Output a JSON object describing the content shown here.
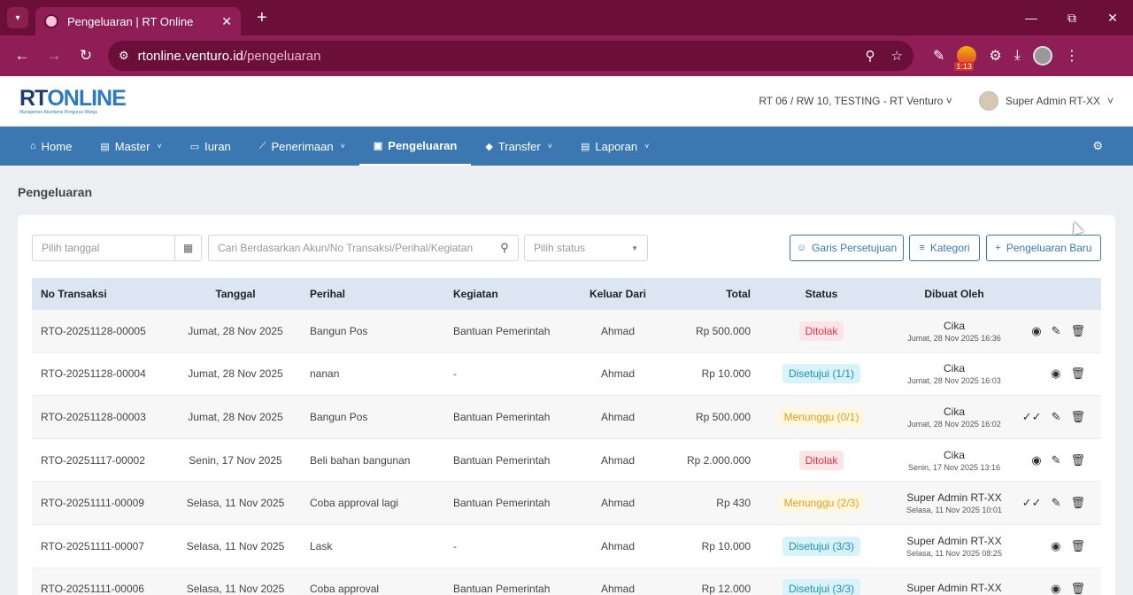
{
  "browser": {
    "tab_title": "Pengeluaran | RT Online",
    "tab_close": "✕",
    "new_tab": "+",
    "url_host": "rtonline.venturo.id",
    "url_path": "/pengeluaran",
    "ext_badge": "1:13"
  },
  "app": {
    "logo_main_a": "RT",
    "logo_main_b": "ONLINE",
    "logo_sub": "Manajemen Akuntansi Pengurus Warga",
    "rt_selector": "RT 06 / RW 10, TESTING - RT Venturo",
    "user_name": "Super Admin RT-XX"
  },
  "nav": {
    "items": [
      {
        "label": "Home",
        "icon": "home-icon"
      },
      {
        "label": "Master",
        "icon": "document-icon"
      },
      {
        "label": "Iuran",
        "icon": "card-icon"
      },
      {
        "label": "Penerimaan",
        "icon": "chart-line-icon"
      },
      {
        "label": "Pengeluaran",
        "icon": "image-icon"
      },
      {
        "label": "Transfer",
        "icon": "tag-icon"
      },
      {
        "label": "Laporan",
        "icon": "document-icon"
      }
    ]
  },
  "page": {
    "title": "Pengeluaran"
  },
  "filters": {
    "date_placeholder": "Pilih tanggal",
    "search_placeholder": "Cari Berdasarkan Akun/No Transaksi/Perihal/Kegiatan",
    "status_placeholder": "Pilih status",
    "btn_approval": "Garis Persetujuan",
    "btn_category": "Kategori",
    "btn_new": "Pengeluaran Baru"
  },
  "table": {
    "headers": [
      "No Transaksi",
      "Tanggal",
      "Perihal",
      "Kegiatan",
      "Keluar Dari",
      "Total",
      "Status",
      "Dibuat Oleh"
    ],
    "rows": [
      {
        "no": "RTO-20251128-00005",
        "tanggal": "Jumat, 28 Nov 2025",
        "perihal": "Bangun Pos",
        "kegiatan": "Bantuan Pemerintah",
        "keluar": "Ahmad",
        "total": "Rp 500.000",
        "status": "Ditolak",
        "status_type": "ditolak",
        "by": "Cika",
        "by_date": "Jumat, 28 Nov 2025 16:36",
        "actions": [
          "view",
          "edit",
          "delete"
        ]
      },
      {
        "no": "RTO-20251128-00004",
        "tanggal": "Jumat, 28 Nov 2025",
        "perihal": "nanan",
        "kegiatan": "-",
        "keluar": "Ahmad",
        "total": "Rp 10.000",
        "status": "Disetujui (1/1)",
        "status_type": "disetujui",
        "by": "Cika",
        "by_date": "Jumat, 28 Nov 2025 16:03",
        "actions": [
          "view",
          "delete"
        ]
      },
      {
        "no": "RTO-20251128-00003",
        "tanggal": "Jumat, 28 Nov 2025",
        "perihal": "Bangun Pos",
        "kegiatan": "Bantuan Pemerintah",
        "keluar": "Ahmad",
        "total": "Rp 500.000",
        "status": "Menunggu (0/1)",
        "status_type": "menunggu",
        "by": "Cika",
        "by_date": "Jumat, 28 Nov 2025 16:02",
        "actions": [
          "approve",
          "edit",
          "delete"
        ]
      },
      {
        "no": "RTO-20251117-00002",
        "tanggal": "Senin, 17 Nov 2025",
        "perihal": "Beli bahan bangunan",
        "kegiatan": "Bantuan Pemerintah",
        "keluar": "Ahmad",
        "total": "Rp 2.000.000",
        "status": "Ditolak",
        "status_type": "ditolak",
        "by": "Cika",
        "by_date": "Senin, 17 Nov 2025 13:16",
        "actions": [
          "view",
          "edit",
          "delete"
        ]
      },
      {
        "no": "RTO-20251111-00009",
        "tanggal": "Selasa, 11 Nov 2025",
        "perihal": "Coba approval lagi",
        "kegiatan": "Bantuan Pemerintah",
        "keluar": "Ahmad",
        "total": "Rp 430",
        "status": "Menunggu (2/3)",
        "status_type": "menunggu",
        "by": "Super Admin RT-XX",
        "by_date": "Selasa, 11 Nov 2025 10:01",
        "actions": [
          "approve",
          "edit",
          "delete"
        ]
      },
      {
        "no": "RTO-20251111-00007",
        "tanggal": "Selasa, 11 Nov 2025",
        "perihal": "Lask",
        "kegiatan": "-",
        "keluar": "Ahmad",
        "total": "Rp 10.000",
        "status": "Disetujui (3/3)",
        "status_type": "disetujui",
        "by": "Super Admin RT-XX",
        "by_date": "Selasa, 11 Nov 2025 08:25",
        "actions": [
          "view",
          "delete"
        ]
      },
      {
        "no": "RTO-20251111-00006",
        "tanggal": "Selasa, 11 Nov 2025",
        "perihal": "Coba approval",
        "kegiatan": "Bantuan Pemerintah",
        "keluar": "Ahmad",
        "total": "Rp 12.000",
        "status": "Disetujui (3/3)",
        "status_type": "disetujui",
        "by": "Super Admin RT-XX",
        "by_date": "",
        "actions": [
          "view",
          "delete"
        ]
      }
    ]
  }
}
